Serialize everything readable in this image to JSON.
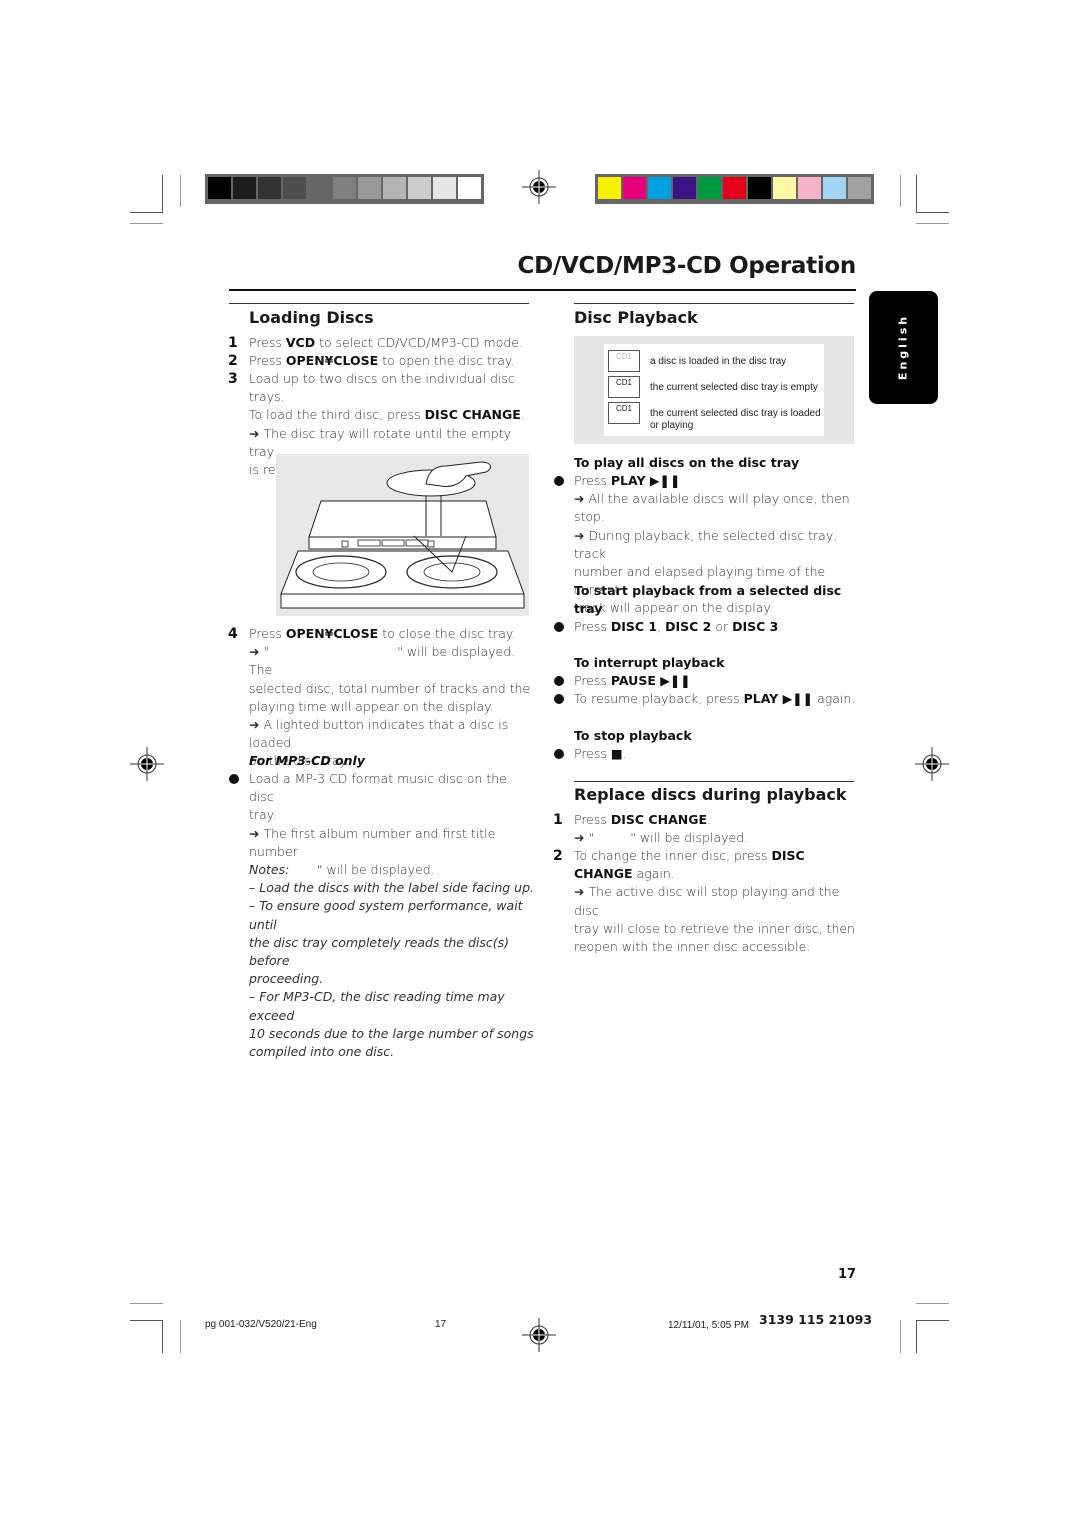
{
  "print_marks": {
    "grayscale_bar": [
      "#000000",
      "#1c1c1c",
      "#333333",
      "#4d4d4d",
      "#666666",
      "#808080",
      "#999999",
      "#b3b3b3",
      "#cccccc",
      "#e6e6e6",
      "#ffffff"
    ],
    "color_bar": [
      "#f7f000",
      "#e6007e",
      "#00a0e3",
      "#3a1583",
      "#009a3e",
      "#e2001a",
      "#000000",
      "#fff8a6",
      "#f6b2c8",
      "#a0d5f3",
      "#a0a0a0"
    ]
  },
  "header": {
    "title": "CD/VCD/MP3-CD Operation"
  },
  "language_tab": {
    "label": "English"
  },
  "loading_discs": {
    "heading": "Loading Discs",
    "steps": [
      {
        "num": "1",
        "pre": "Press ",
        "key": "VCD",
        "post": " to select CD/VCD/MP3-CD mode."
      },
      {
        "num": "2",
        "pre": "Press ",
        "key": "OPEN¥CLOSE",
        "post": " to open the disc tray."
      },
      {
        "num": "3",
        "line1": "Load up to two discs on the individual disc trays.",
        "line2_pre": "To load the third disc, press ",
        "line2_key": "DISC CHANGE",
        "line2_post": ".",
        "arrow_text": "The disc tray will rotate until the empty tray",
        "arrow_text2": "is ready for loading."
      },
      {
        "num": "4",
        "pre": "Press ",
        "key": "OPEN¥CLOSE",
        "post": " to close the disc tray.",
        "arrow1_a": "\"",
        "arrow1_b": "\" will be displayed. The",
        "cont1": "selected disc, total number of tracks and the",
        "cont2": "playing time will appear on the display.",
        "arrow2": "A lighted button indicates that a disc is loaded",
        "arrow2b": "on the disc tray."
      }
    ],
    "mp3": {
      "heading": "For MP3-CD only",
      "bullet1": "Load a MP-3 CD format music disc on the disc",
      "bullet1b": "tray.",
      "arrow": "The first album number and first title number",
      "arrow_b1": "\"",
      "arrow_b2": "\" will be displayed."
    },
    "notes": {
      "heading": "Notes:",
      "n1": "–  Load the discs with the label side facing up.",
      "n2a": "–  To ensure good system performance, wait until",
      "n2b": "the disc tray completely reads the disc(s) before",
      "n2c": "proceeding.",
      "n3a": "–  For MP3-CD, the disc reading time may exceed",
      "n3b": "10 seconds due to the large number of songs",
      "n3c": "compiled into one disc."
    }
  },
  "disc_playback": {
    "heading": "Disc Playback",
    "legend": [
      {
        "icon": "disc-loaded-icon",
        "icon_label": "CD1",
        "text": "a disc is loaded in the disc tray"
      },
      {
        "icon": "tray-empty-icon",
        "icon_label": "CD1",
        "text": "the current selected disc tray is empty"
      },
      {
        "icon": "tray-playing-icon",
        "icon_label": "CD1",
        "text": "the current selected disc tray is loaded",
        "text2": "or playing"
      }
    ],
    "play_all": {
      "heading": "To play all discs on the disc tray",
      "bullet_pre": "Press ",
      "bullet_key": "PLAY ▶❚❚",
      "arrow1": "All the available discs will play once, then stop.",
      "arrow2": "During playback, the selected disc tray, track",
      "cont1": "number and elapsed playing time of the current",
      "cont2": "track will appear on the display."
    },
    "start_selected": {
      "heading1": "To start playback from a selected disc",
      "heading2": "tray",
      "pre": "Press ",
      "k1": "DISC 1",
      "sep1": ", ",
      "k2": "DISC 2",
      "sep2": " or ",
      "k3": "DISC 3",
      "post": "."
    },
    "interrupt": {
      "heading": "To interrupt playback",
      "b1_pre": "Press ",
      "b1_key": "PAUSE ▶❚❚",
      "b2_pre": "To resume playback, press ",
      "b2_key": "PLAY ▶❚❚",
      "b2_post": " again."
    },
    "stop": {
      "heading": "To stop playback",
      "pre": "Press ",
      "key": "■",
      "post": "."
    }
  },
  "replace_discs": {
    "heading": "Replace discs during playback",
    "s1_pre": "Press ",
    "s1_key": "DISC CHANGE",
    "s1_post": ".",
    "s1_arrow_a": "\"",
    "s1_arrow_b": "\" will be displayed.",
    "s2_pre": "To change the inner disc, press ",
    "s2_key1": "DISC",
    "s2_key2": "CHANGE",
    "s2_post": " again.",
    "s2_arrow": "The active disc will stop playing and the disc",
    "s2_cont1": "tray will close to retrieve the inner disc, then",
    "s2_cont2": "reopen with the inner disc accessible."
  },
  "page_number": "17",
  "footer": {
    "file": "pg 001-032/V520/21-Eng",
    "page": "17",
    "date": "12/11/01, 5:05 PM",
    "code": "3139 115 21093"
  }
}
